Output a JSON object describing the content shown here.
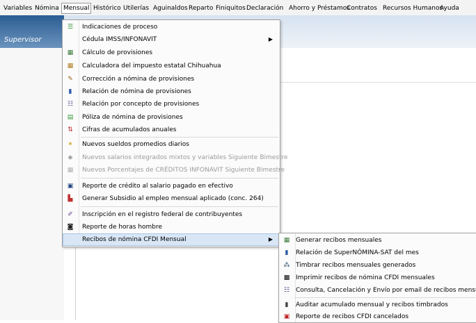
{
  "menubar": [
    "Variables",
    "Nómina",
    "Mensual",
    "Histórico",
    "Utilerías",
    "Aguinaldos",
    "Reparto",
    "Finiquitos",
    "Declaración",
    "Ahorro y Préstamos",
    "Contratos",
    "Recursos Humanos",
    "Ayuda"
  ],
  "user": "Supervisor",
  "mensual_menu": [
    {
      "label": "Indicaciones de proceso",
      "icon": "list-green-icon"
    },
    {
      "label": "Cédula IMSS/INFONAVIT",
      "icon": "",
      "submenu": true
    },
    {
      "label": "Cálculo de provisiones",
      "icon": "calculator-icon"
    },
    {
      "label": "Calculadora del impuesto estatal Chihuahua",
      "icon": "calculator-icon"
    },
    {
      "label": "Corrección a nómina de provisiones",
      "icon": "edit-sheet-icon"
    },
    {
      "label": "Relación de nómina de provisiones",
      "icon": "bar-chart-icon"
    },
    {
      "label": "Relación por concepto de provisiones",
      "icon": "list-icon"
    },
    {
      "label": "Póliza de nómina de provisiones",
      "icon": "ledger-icon"
    },
    {
      "label": "Cifras de acumulados anuales",
      "icon": "arrows-icon"
    },
    {
      "label": "Nuevos sueldos promedios diarios",
      "icon": "spark-icon"
    },
    {
      "label": "Nuevos salarios integrados mixtos y variables Siguiente Bimestre",
      "icon": "shield-icon",
      "disabled": true
    },
    {
      "label": "Nuevos Porcentajes de CRÉDITOS INFONAVIT Siguiente Bimestre",
      "icon": "grid-icon",
      "disabled": true
    },
    {
      "label": "Reporte de crédito al salario pagado en efectivo",
      "icon": "report-icon"
    },
    {
      "label": "Generar Subsidio al empleo mensual aplicado (conc. 264)",
      "icon": "subsidy-icon"
    },
    {
      "label": "Inscripción en el registro federal de contribuyentes",
      "icon": "register-icon"
    },
    {
      "label": "Reporte de horas hombre",
      "icon": "clock-report-icon"
    },
    {
      "label": "Recibos de nómina CFDI Mensual",
      "icon": "",
      "submenu": true,
      "active": true
    }
  ],
  "cfdi_menu": [
    {
      "label": "Generar recibos mensuales",
      "icon": "calculator-icon"
    },
    {
      "label": "Relación de SuperNÓMINA-SAT del mes",
      "icon": "bar-chart-icon"
    },
    {
      "label": "Timbrar recibos mensuales generados",
      "icon": "sat-icon"
    },
    {
      "label": "Imprimir recibos de nómina CFDI mensuales",
      "icon": "qr-icon"
    },
    {
      "label": "Consulta, Cancelación y Envío por email de recibos mensuales",
      "icon": "list-icon"
    },
    {
      "label": "Auditar acumulado mensual y recibos timbrados",
      "icon": "audit-icon"
    },
    {
      "label": "Reporte de recibos CFDI cancelados",
      "icon": "cfdi-cancel-icon"
    }
  ]
}
